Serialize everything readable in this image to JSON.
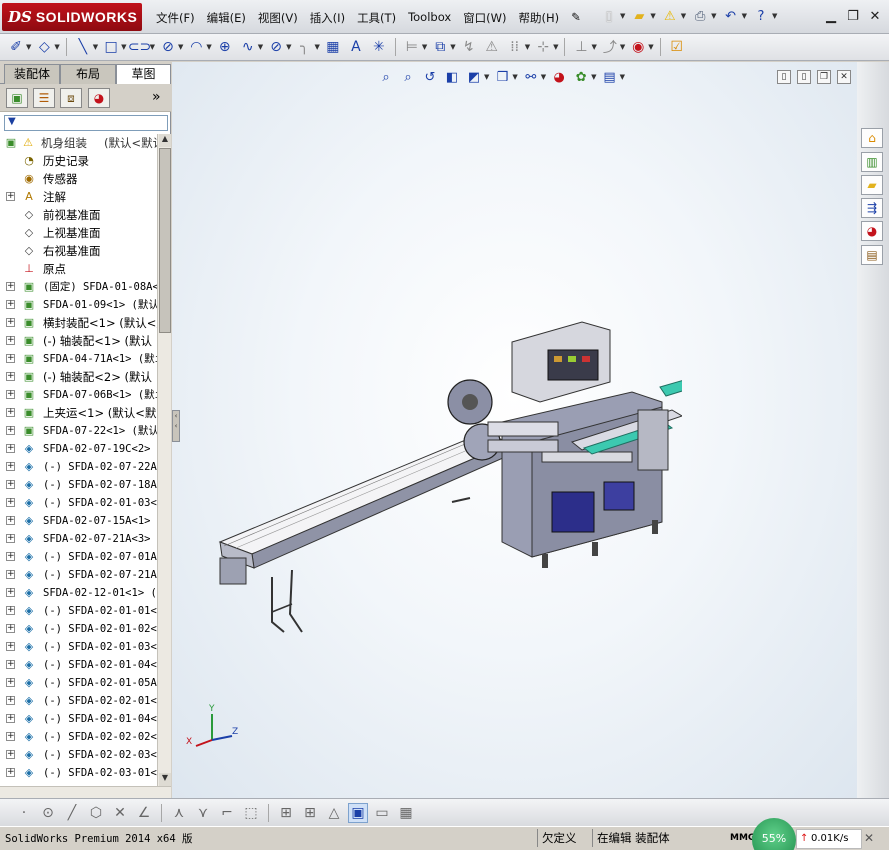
{
  "app": {
    "logo_ds": "DS",
    "logo_name": "SOLIDWORKS"
  },
  "menu": [
    {
      "label": "文件(F)"
    },
    {
      "label": "编辑(E)"
    },
    {
      "label": "视图(V)"
    },
    {
      "label": "插入(I)"
    },
    {
      "label": "工具(T)"
    },
    {
      "label": "Toolbox"
    },
    {
      "label": "窗口(W)"
    },
    {
      "label": "帮助(H)"
    }
  ],
  "left_panel": {
    "tabs": [
      "装配体",
      "布局",
      "草图"
    ],
    "active_tab": "草图",
    "expand_symbol": "»",
    "filter_symbol": "▼",
    "root": {
      "label": "机身组装",
      "config": "(默认<默认"
    },
    "items": [
      {
        "label": "历史记录",
        "icon": "history-icon",
        "expand": false,
        "mono": false
      },
      {
        "label": "传感器",
        "icon": "sensor-icon",
        "expand": false,
        "mono": false
      },
      {
        "label": "注解",
        "icon": "annotation-icon",
        "expand": true,
        "mono": false
      },
      {
        "label": "前视基准面",
        "icon": "plane-icon",
        "expand": false,
        "mono": false
      },
      {
        "label": "上视基准面",
        "icon": "plane-icon",
        "expand": false,
        "mono": false
      },
      {
        "label": "右视基准面",
        "icon": "plane-icon",
        "expand": false,
        "mono": false
      },
      {
        "label": "原点",
        "icon": "origin-icon",
        "expand": false,
        "mono": false
      },
      {
        "label": "(固定) SFDA-01-08A<",
        "icon": "subassembly-icon",
        "expand": true,
        "mono": true
      },
      {
        "label": "SFDA-01-09<1> (默认",
        "icon": "subassembly-icon",
        "expand": true,
        "mono": true
      },
      {
        "label": "横封装配<1> (默认<默",
        "icon": "subassembly-icon",
        "expand": true,
        "mono": false
      },
      {
        "label": "(-) 轴装配<1> (默认",
        "icon": "subassembly-icon",
        "expand": true,
        "mono": false
      },
      {
        "label": "SFDA-04-71A<1> (默i",
        "icon": "subassembly-icon",
        "expand": true,
        "mono": true
      },
      {
        "label": "(-) 轴装配<2> (默认",
        "icon": "subassembly-icon",
        "expand": true,
        "mono": false
      },
      {
        "label": "SFDA-07-06B<1> (默i",
        "icon": "subassembly-icon",
        "expand": true,
        "mono": true
      },
      {
        "label": "上夹运<1> (默认<默i",
        "icon": "subassembly-icon",
        "expand": true,
        "mono": false
      },
      {
        "label": "SFDA-07-22<1> (默认",
        "icon": "subassembly-icon",
        "expand": true,
        "mono": true
      },
      {
        "label": "SFDA-02-07-19C<2> (",
        "icon": "part-icon",
        "expand": true,
        "mono": true
      },
      {
        "label": "(-) SFDA-02-07-22A<",
        "icon": "part-icon",
        "expand": true,
        "mono": true
      },
      {
        "label": "(-) SFDA-02-07-18A<",
        "icon": "part-icon",
        "expand": true,
        "mono": true
      },
      {
        "label": "(-) SFDA-02-01-03<1",
        "icon": "part-icon",
        "expand": true,
        "mono": true
      },
      {
        "label": "SFDA-02-07-15A<1> (",
        "icon": "part-icon",
        "expand": true,
        "mono": true
      },
      {
        "label": "SFDA-02-07-21A<3> (",
        "icon": "part-icon",
        "expand": true,
        "mono": true
      },
      {
        "label": "(-) SFDA-02-07-01A<",
        "icon": "part-icon",
        "expand": true,
        "mono": true
      },
      {
        "label": "(-) SFDA-02-07-21A<",
        "icon": "part-icon",
        "expand": true,
        "mono": true
      },
      {
        "label": "SFDA-02-12-01<1> (默",
        "icon": "part-icon",
        "expand": true,
        "mono": true
      },
      {
        "label": "(-) SFDA-02-01-01<1",
        "icon": "part-icon",
        "expand": true,
        "mono": true
      },
      {
        "label": "(-) SFDA-02-01-02<1",
        "icon": "part-icon",
        "expand": true,
        "mono": true
      },
      {
        "label": "(-) SFDA-02-01-03<2",
        "icon": "part-icon",
        "expand": true,
        "mono": true
      },
      {
        "label": "(-) SFDA-02-01-04<1",
        "icon": "part-icon",
        "expand": true,
        "mono": true
      },
      {
        "label": "(-) SFDA-02-01-05A<",
        "icon": "part-icon",
        "expand": true,
        "mono": true
      },
      {
        "label": "(-) SFDA-02-02-01<1",
        "icon": "part-icon",
        "expand": true,
        "mono": true
      },
      {
        "label": "(-) SFDA-02-01-04<2",
        "icon": "part-icon",
        "expand": true,
        "mono": true
      },
      {
        "label": "(-) SFDA-02-02-02<2",
        "icon": "part-icon",
        "expand": true,
        "mono": true
      },
      {
        "label": "(-) SFDA-02-02-03<1",
        "icon": "part-icon",
        "expand": true,
        "mono": true
      },
      {
        "label": "(-) SFDA-02-03-01<1",
        "icon": "part-icon",
        "expand": true,
        "mono": true
      }
    ]
  },
  "triad": {
    "x": "X",
    "y": "Y",
    "z": "Z"
  },
  "status": {
    "product": "SolidWorks Premium 2014 x64 版",
    "definition": "欠定义",
    "mode": "在编辑 装配体",
    "units": "MMGS",
    "progress": "55%",
    "net_speed": "0.01K/s",
    "net_arrow": "↑"
  },
  "colors": {
    "brand_red": "#c1121b",
    "accent_blue": "#1b3fa8",
    "model_gray": "#8f93a6",
    "model_teal": "#3cc9b0"
  }
}
